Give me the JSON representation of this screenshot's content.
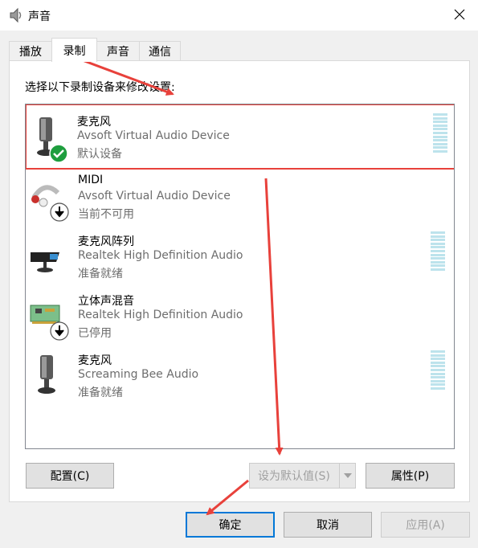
{
  "window": {
    "title": "声音",
    "icon": "speaker-icon",
    "close_icon": "close-icon"
  },
  "tabs": [
    {
      "label": "播放",
      "active": false
    },
    {
      "label": "录制",
      "active": true
    },
    {
      "label": "声音",
      "active": false
    },
    {
      "label": "通信",
      "active": false
    }
  ],
  "instruction": "选择以下录制设备来修改设置:",
  "devices": [
    {
      "name": "麦克风",
      "description": "Avsoft Virtual Audio Device",
      "status": "默认设备",
      "icon": "microphone-icon",
      "badge": "default-check-icon",
      "selected": true,
      "meter": true
    },
    {
      "name": "MIDI",
      "description": "Avsoft Virtual Audio Device",
      "status": "当前不可用",
      "icon": "audio-cable-icon",
      "badge": "down-arrow-icon",
      "selected": false,
      "meter": false
    },
    {
      "name": "麦克风阵列",
      "description": "Realtek High Definition Audio",
      "status": "准备就绪",
      "icon": "webcam-bar-icon",
      "badge": "",
      "selected": false,
      "meter": true
    },
    {
      "name": "立体声混音",
      "description": "Realtek High Definition Audio",
      "status": "已停用",
      "icon": "sound-card-icon",
      "badge": "down-arrow-icon",
      "selected": false,
      "meter": false
    },
    {
      "name": "麦克风",
      "description": "Screaming Bee Audio",
      "status": "准备就绪",
      "icon": "microphone-icon",
      "badge": "",
      "selected": false,
      "meter": true
    }
  ],
  "buttons": {
    "configure": "配置(C)",
    "set_default": "设为默认值(S)",
    "properties": "属性(P)",
    "ok": "确定",
    "cancel": "取消",
    "apply": "应用(A)"
  },
  "colors": {
    "annotation": "#e8413b",
    "meter": "#bde3ec",
    "check_badge": "#1e9e3e"
  }
}
